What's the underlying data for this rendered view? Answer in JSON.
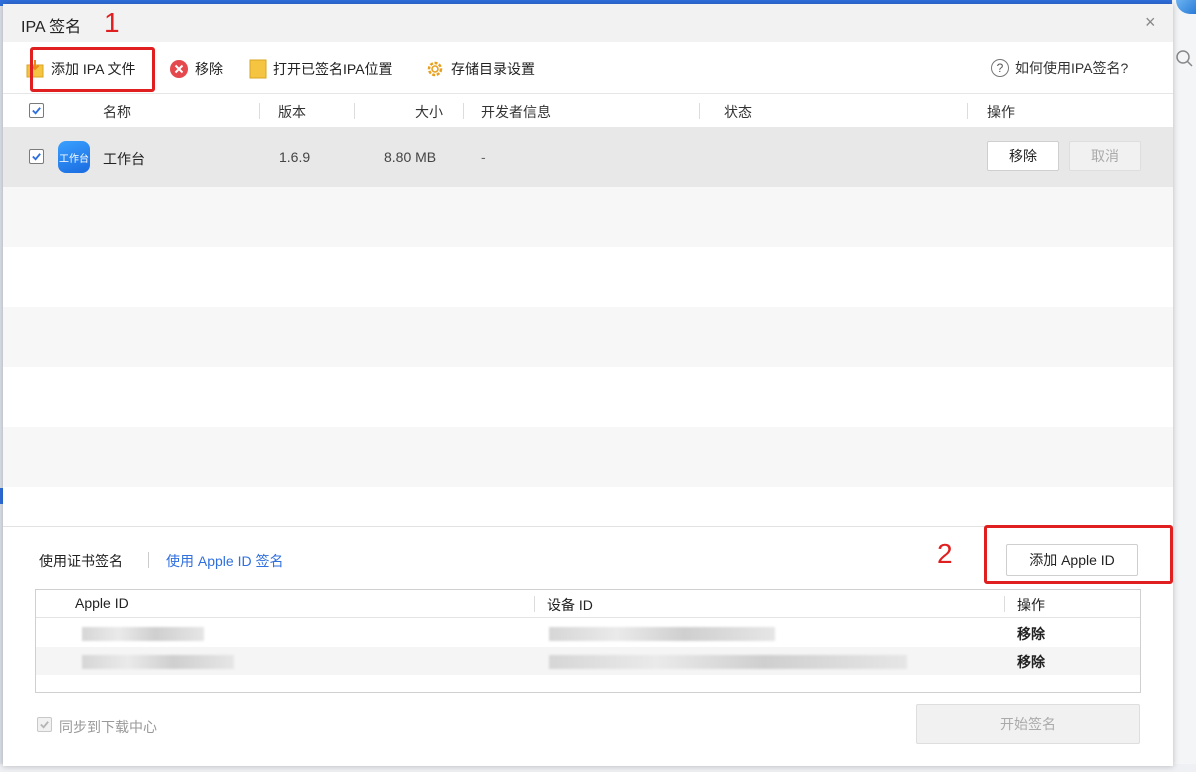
{
  "dialog": {
    "title": "IPA 签名",
    "close_glyph": "×"
  },
  "toolbar": {
    "add_ipa": "添加 IPA 文件",
    "remove": "移除",
    "open_signed": "打开已签名IPA位置",
    "storage_settings": "存储目录设置",
    "help": "如何使用IPA签名?"
  },
  "table": {
    "headers": {
      "name": "名称",
      "version": "版本",
      "size": "大小",
      "developer": "开发者信息",
      "status": "状态",
      "actions": "操作"
    },
    "rows": [
      {
        "checked": true,
        "icon_text": "工作台",
        "name": "工作台",
        "version": "1.6.9",
        "size": "8.80 MB",
        "developer": "-",
        "status": "",
        "remove_label": "移除",
        "cancel_label": "取消"
      }
    ]
  },
  "signing": {
    "tab_cert": "使用证书签名",
    "tab_apple_id": "使用 Apple ID 签名",
    "add_apple_id": "添加 Apple ID",
    "id_table": {
      "headers": {
        "apple_id": "Apple ID",
        "device_id": "设备 ID",
        "actions": "操作"
      },
      "rows": [
        {
          "action": "移除"
        },
        {
          "action": "移除"
        }
      ]
    },
    "sync_label": "同步到下载中心",
    "sync_checked": true,
    "start_button": "开始签名"
  },
  "annotations": {
    "marker_1": "1",
    "marker_2": "2",
    "color": "#e02020"
  },
  "colors": {
    "link_blue": "#2f6fde",
    "selected_row": "#e8e8e8",
    "remove_icon_red": "#e5484d",
    "folder_yellow": "#f5c542"
  }
}
